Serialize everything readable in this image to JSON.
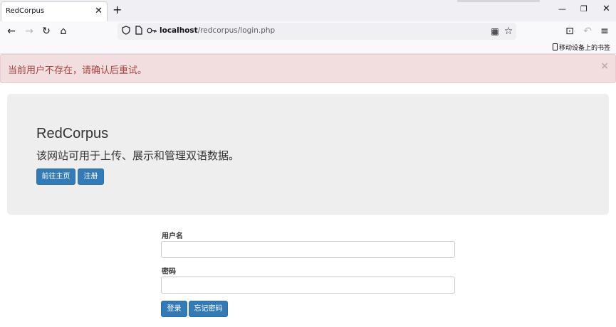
{
  "tab": {
    "title": "RedCorpus",
    "close": "✕",
    "new_tab": "+"
  },
  "window_controls": {
    "minimize": "—",
    "maximize": "❐",
    "close": "✕"
  },
  "toolbar": {
    "back": "←",
    "forward": "→",
    "reload": "↻",
    "home": "⌂",
    "url_host": "localhost",
    "url_path": "/redcorpus/login.php",
    "qr": "▦",
    "bookmark_star": "☆",
    "crop": "⊡",
    "undo": "↶",
    "menu": "≡"
  },
  "icons": {
    "shield": "shield-icon",
    "page": "page-icon",
    "key": "key-icon"
  },
  "bookmarks": {
    "mobile_label": "移动设备上的书签"
  },
  "alert": {
    "text": "当前用户不存在，请确认后重试。",
    "close": "×",
    "bg": "#f2dede",
    "color": "#a94442"
  },
  "jumbotron": {
    "title": "RedCorpus",
    "subtitle": "该网站可用于上传、展示和管理双语数据。",
    "home_button": "前往主页",
    "register_button": "注册"
  },
  "login_form": {
    "username_label": "用户名",
    "username_value": "",
    "password_label": "密码",
    "password_value": "",
    "login_button": "登录",
    "forgot_button": "忘记密码"
  },
  "colors": {
    "primary": "#337ab7",
    "jumbotron_bg": "#eeeeee"
  }
}
